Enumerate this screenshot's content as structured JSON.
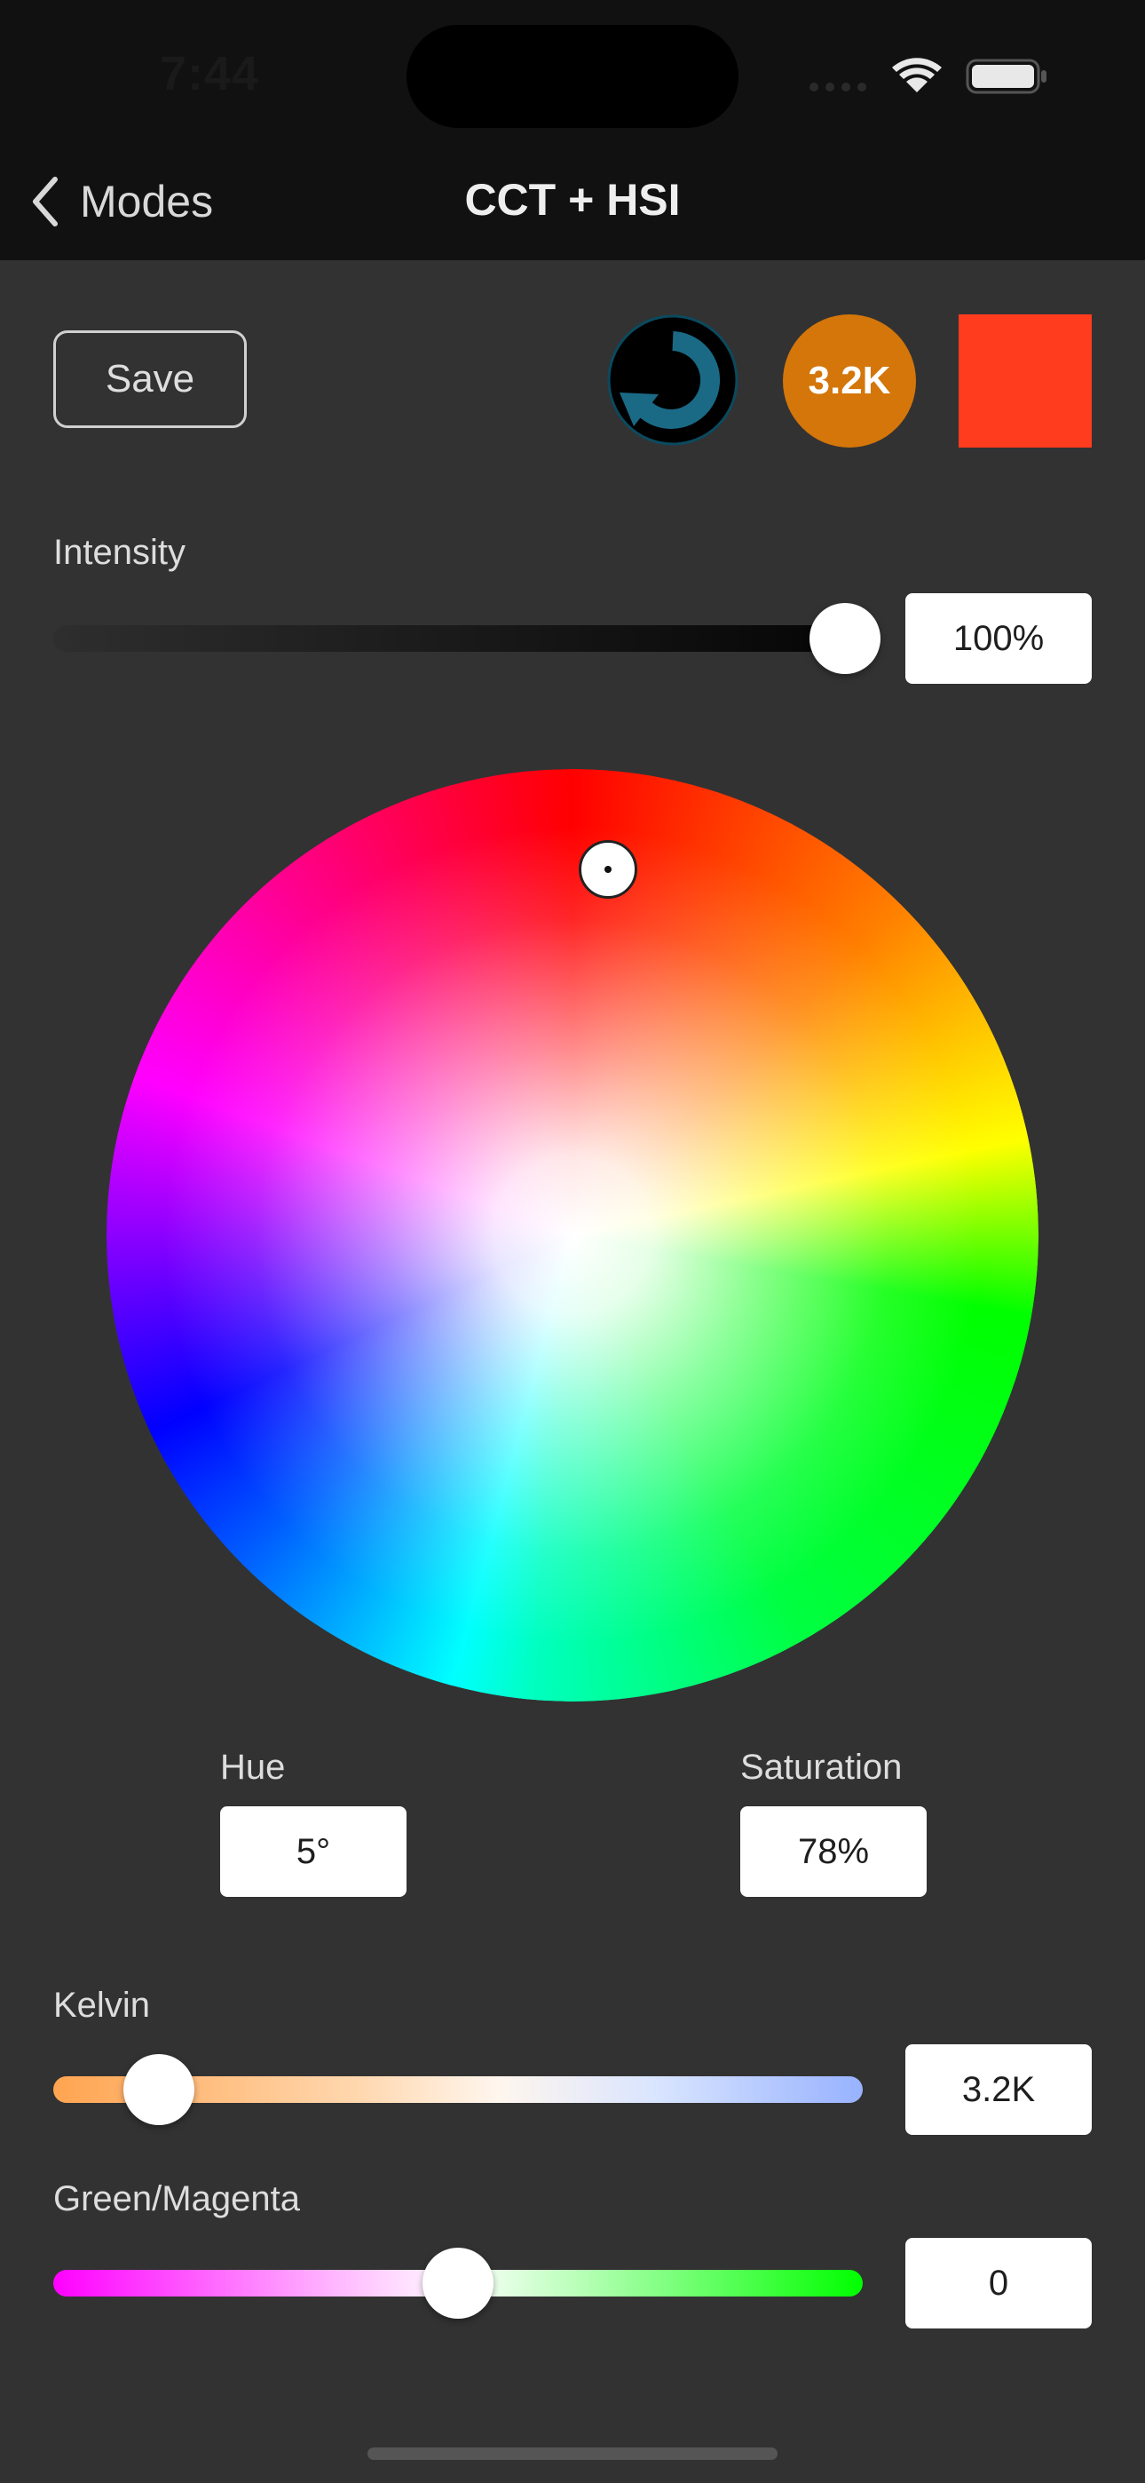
{
  "status_bar": {
    "time": "7:44"
  },
  "nav": {
    "back_label": "Modes",
    "title": "CCT + HSI"
  },
  "toolbar": {
    "save_label": "Save",
    "cct_badge": "3.2K",
    "swatch_color": "#ff3c1e",
    "reset_icon": "refresh-icon"
  },
  "intensity": {
    "label": "Intensity",
    "value": "100%",
    "level": 1.0
  },
  "color_wheel": {
    "hue_deg": 5,
    "saturation": 0.78
  },
  "hue": {
    "label": "Hue",
    "value": "5°"
  },
  "saturation": {
    "label": "Saturation",
    "value": "78%"
  },
  "kelvin": {
    "label": "Kelvin",
    "value": "3.2K",
    "level": 0.13
  },
  "green_magenta": {
    "label": "Green/Magenta",
    "value": "0",
    "level": 0.5
  },
  "colors": {
    "accent_orange": "#d4760a",
    "background": "#323232",
    "nav_background": "#111111"
  }
}
